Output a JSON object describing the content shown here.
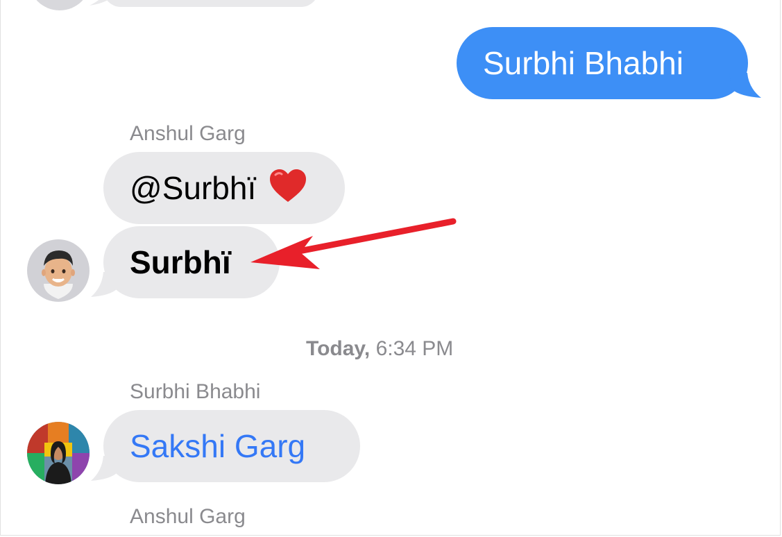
{
  "conversation": {
    "top_partial_message": {
      "direction": "received"
    },
    "sent_message": {
      "text": "Surbhi Bhabhi"
    },
    "group1": {
      "sender": "Anshul Garg",
      "message1": {
        "text": "@Surbhï",
        "emoji": "heart-emoji"
      },
      "message2": {
        "text": "Surbhï"
      },
      "avatar": "memoji-avatar-icon"
    },
    "timestamp": {
      "day": "Today,",
      "time": "6:34 PM"
    },
    "group2": {
      "sender": "Surbhi Bhabhi",
      "message": {
        "text": "Sakshi Garg"
      },
      "avatar": "photo-avatar-icon"
    },
    "group3": {
      "sender": "Anshul Garg"
    }
  },
  "annotation": {
    "type": "arrow",
    "color": "#e8202a"
  },
  "colors": {
    "sent_bubble": "#3d8ff6",
    "received_bubble": "#e9e9eb",
    "mention_blue": "#3478f6",
    "meta_gray": "#8a8a8e"
  }
}
